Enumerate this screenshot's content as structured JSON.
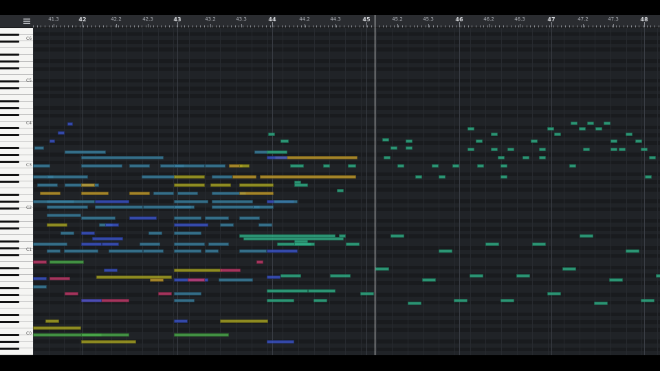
{
  "window": {
    "menu_icon": "list-icon"
  },
  "ruler": {
    "markers": [
      {
        "label": "41.3",
        "major": false
      },
      {
        "label": "42",
        "major": true
      },
      {
        "label": "42.2",
        "major": false
      },
      {
        "label": "42.3",
        "major": false
      },
      {
        "label": "43",
        "major": true
      },
      {
        "label": "43.2",
        "major": false
      },
      {
        "label": "43.3",
        "major": false
      },
      {
        "label": "44",
        "major": true
      },
      {
        "label": "44.2",
        "major": false
      },
      {
        "label": "44.3",
        "major": false
      },
      {
        "label": "45",
        "major": true
      },
      {
        "label": "45.2",
        "major": false
      },
      {
        "label": "45.3",
        "major": false
      },
      {
        "label": "46",
        "major": true
      },
      {
        "label": "46.2",
        "major": false
      },
      {
        "label": "46.3",
        "major": false
      },
      {
        "label": "47",
        "major": true
      },
      {
        "label": "47.2",
        "major": false
      },
      {
        "label": "47.3",
        "major": false
      },
      {
        "label": "48",
        "major": true
      }
    ]
  },
  "keyboard": {
    "octave_labels": [
      "C6",
      "C5",
      "C4",
      "C3",
      "C2",
      "C1",
      "C0"
    ]
  },
  "colors": {
    "teal": "#2fae86",
    "steel": "#3a7f9e",
    "blue": "#3a53c7",
    "olive": "#a7a322",
    "ochre": "#c09a2a",
    "magenta": "#c23a6a",
    "green": "#4aa84a",
    "grid_bg": "#1c1e22",
    "playhead": "#e8e8e8"
  },
  "playhead_position": "45"
}
